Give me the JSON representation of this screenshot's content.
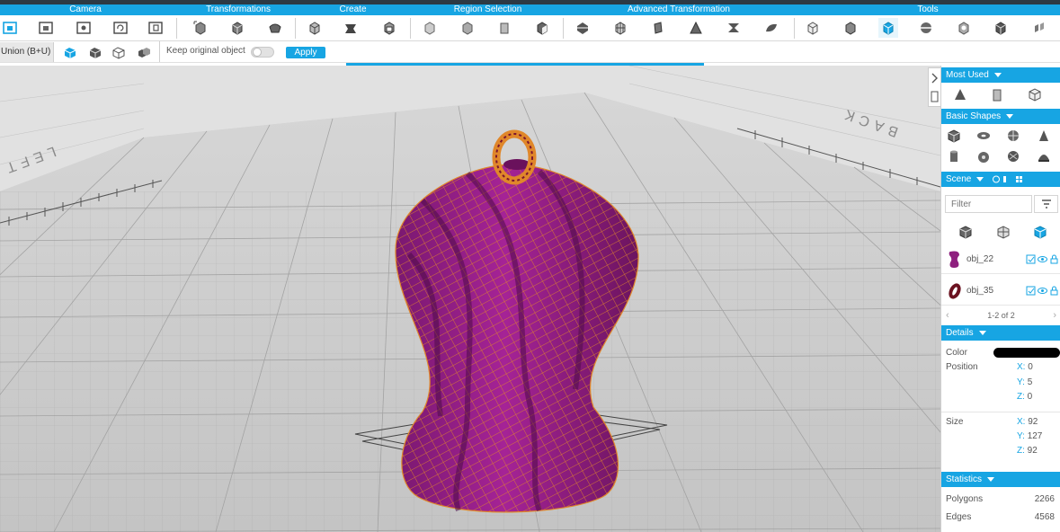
{
  "ribbon": {
    "categories": [
      "Camera",
      "Transformations",
      "Create",
      "Region Selection",
      "Advanced Transformation",
      "Tools"
    ]
  },
  "options": {
    "mode_label": "Union (B+U)",
    "keep_original_label": "Keep original object",
    "apply_label": "Apply"
  },
  "viewport": {
    "label_left": "LEFT",
    "label_back": "BACK"
  },
  "panel": {
    "most_used": "Most Used",
    "basic_shapes": "Basic Shapes",
    "scene": "Scene",
    "filter_placeholder": "Filter",
    "objects": [
      {
        "name": "obj_22",
        "color": "#8e1f7e"
      },
      {
        "name": "obj_35",
        "color": "#6b1220"
      }
    ],
    "pager": "1-2 of 2",
    "details": "Details",
    "color_label": "Color",
    "color_value": "#000000",
    "position_label": "Position",
    "position": {
      "x": "0",
      "y": "5",
      "z": "0"
    },
    "size_label": "Size",
    "size": {
      "x": "92",
      "y": "127",
      "z": "92"
    },
    "statistics": "Statistics",
    "polygons_label": "Polygons",
    "polygons": "2266",
    "edges_label": "Edges",
    "edges": "4568"
  },
  "colors": {
    "accent": "#17a5e3",
    "model": "#8e1f7e",
    "wire": "#e0872a"
  }
}
